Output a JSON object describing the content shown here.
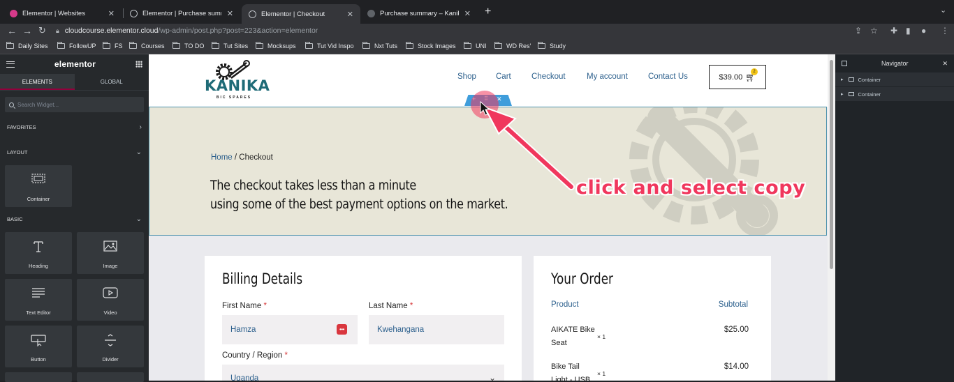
{
  "browser": {
    "tabs": [
      {
        "title": "Elementor | Websites",
        "active": false
      },
      {
        "title": "Elementor | Purchase summary",
        "active": false
      },
      {
        "title": "Elementor | Checkout",
        "active": true
      },
      {
        "title": "Purchase summary – Kanika Pa",
        "active": false
      }
    ],
    "url_host": "cloudcourse.elementor.cloud",
    "url_path": "/wp-admin/post.php?post=223&action=elementor",
    "bookmarks": [
      "Daily Sites",
      "FollowUP",
      "FS",
      "Courses",
      "TO DO",
      "Tut Sites",
      "Mocksups",
      "Tut Vid Inspo",
      "Nxt Tuts",
      "Stock Images",
      "UNI",
      "WD Res'",
      "Study"
    ]
  },
  "editor": {
    "logo": "elementor",
    "tabs": [
      "ELEMENTS",
      "GLOBAL"
    ],
    "search_placeholder": "Search Widget...",
    "sections": {
      "favorites": "FAVORITES",
      "layout": "LAYOUT",
      "basic": "BASIC"
    },
    "widgets": {
      "container": "Container",
      "heading": "Heading",
      "image": "Image",
      "text_editor": "Text Editor",
      "video": "Video",
      "button": "Button",
      "divider": "Divider"
    }
  },
  "site": {
    "brand": "KANIKA",
    "brand_sub": "BIC SPARES",
    "menu": [
      "Shop",
      "Cart",
      "Checkout",
      "My account",
      "Contact Us"
    ],
    "cart_total": "$39.00",
    "cart_count": "2",
    "breadcrumb_home": "Home",
    "breadcrumb_current": "/ Checkout",
    "hero_line1": "The checkout takes less than a minute",
    "hero_line2": "using some of the best payment options on the market.",
    "billing": {
      "title": "Billing Details",
      "first_name_label": "First Name",
      "first_name_value": "Hamza",
      "last_name_label": "Last Name",
      "last_name_value": "Kwehangana",
      "country_label": "Country / Region",
      "country_value": "Uganda",
      "required_mark": "*"
    },
    "order": {
      "title": "Your Order",
      "col_product": "Product",
      "col_subtotal": "Subtotal",
      "items": [
        {
          "name_line1": "AIKATE Bike",
          "name_line2": "Seat",
          "qty": "× 1",
          "price": "$25.00"
        },
        {
          "name_line1": "Bike Tail",
          "name_line2": "Light - USB",
          "qty": "× 1",
          "price": "$14.00"
        }
      ]
    }
  },
  "annotation": {
    "text": "click and select copy",
    "color": "#f0375d"
  },
  "navigator": {
    "title": "Navigator",
    "items": [
      "Container",
      "Container"
    ]
  },
  "colors": {
    "editor_accent": "#93003c",
    "link_blue": "#2b5f8c",
    "brand_teal": "#1f6b77",
    "hero_bg": "#e8e6d8",
    "handle_blue": "#3f9ddb"
  }
}
